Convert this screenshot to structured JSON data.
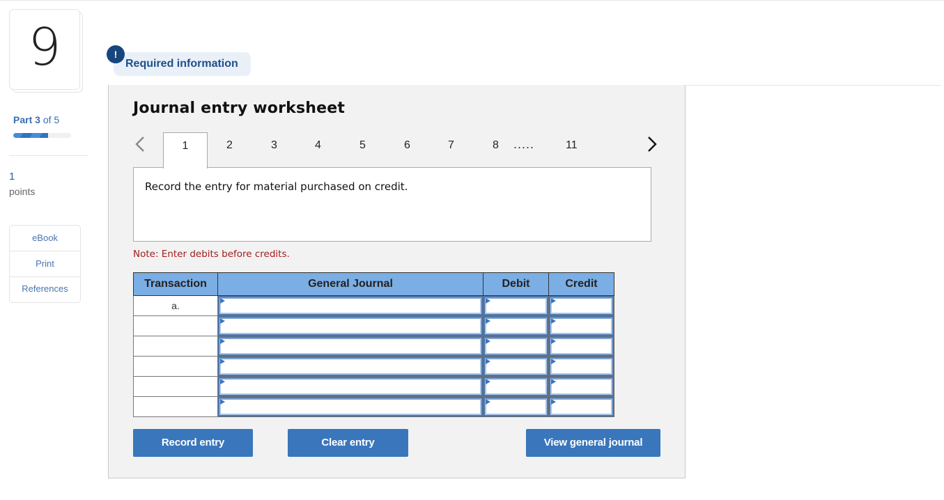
{
  "question": {
    "number": "9",
    "part_prefix": "Part",
    "part_current": "3",
    "part_suffix": "of 5",
    "part_progress": 0.6,
    "points_value": "1",
    "points_label": "points"
  },
  "side_links": [
    "eBook",
    "Print",
    "References"
  ],
  "required_info": {
    "icon": "exclamation-icon",
    "icon_glyph": "!",
    "label": "Required information"
  },
  "worksheet": {
    "title": "Journal entry worksheet",
    "pager": {
      "prev_icon": "chevron-left-icon",
      "next_icon": "chevron-right-icon",
      "active_tab": "1",
      "tabs": [
        "1",
        "2",
        "3",
        "4",
        "5",
        "6",
        "7",
        "8"
      ],
      "ellipsis": ".....",
      "last_tab": "11"
    },
    "instruction": "Record the entry for material purchased on credit.",
    "note": "Note: Enter debits before credits.",
    "table": {
      "headers": [
        "Transaction",
        "General Journal",
        "Debit",
        "Credit"
      ],
      "rows": [
        {
          "transaction": "a.",
          "account": "",
          "debit": "",
          "credit": ""
        },
        {
          "transaction": "",
          "account": "",
          "debit": "",
          "credit": ""
        },
        {
          "transaction": "",
          "account": "",
          "debit": "",
          "credit": ""
        },
        {
          "transaction": "",
          "account": "",
          "debit": "",
          "credit": ""
        },
        {
          "transaction": "",
          "account": "",
          "debit": "",
          "credit": ""
        },
        {
          "transaction": "",
          "account": "",
          "debit": "",
          "credit": ""
        }
      ]
    },
    "buttons": {
      "record": "Record entry",
      "clear": "Clear entry",
      "view": "View general journal"
    }
  },
  "colors": {
    "accent": "#3a76bc",
    "header_blue": "#7aaee4",
    "note_red": "#a31c1c",
    "info_navy": "#17467f"
  }
}
